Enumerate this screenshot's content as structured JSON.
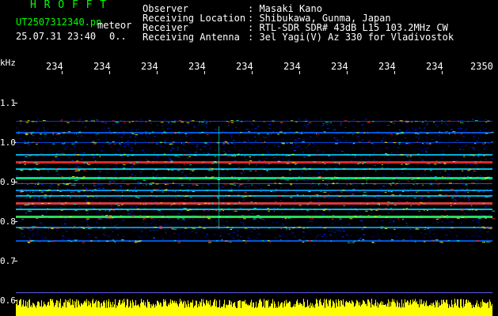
{
  "header": {
    "app_name": "H R O F F T",
    "filename": "UT2507312340.pn",
    "mode": "meteor",
    "datetime": "25.07.31 23:40",
    "status": "0..",
    "fields": [
      {
        "label": "Observer",
        "value": ": Masaki Kano"
      },
      {
        "label": "Receiving Location",
        "value": ": Shibukawa, Gunma, Japan"
      },
      {
        "label": "Receiver",
        "value": ": RTL-SDR SDR# 43dB L15 103.2MHz CW"
      },
      {
        "label": "Receiving Antenna",
        "value": ": 3el Yagi(V) Az 330 for Vladivostok"
      }
    ]
  },
  "axis": {
    "y_unit": "kHz",
    "x_ticks": [
      "234",
      "234",
      "234",
      "234",
      "234",
      "234",
      "234",
      "234",
      "234",
      "2350"
    ],
    "y_ticks": [
      "1.1",
      "1.0",
      "0.9",
      "0.8",
      "0.7",
      "0.6"
    ]
  },
  "colors": {
    "header_green": "#00ff00",
    "header_white": "#ffffff",
    "signal_yellow": "#ffff00",
    "background": "#000000"
  }
}
